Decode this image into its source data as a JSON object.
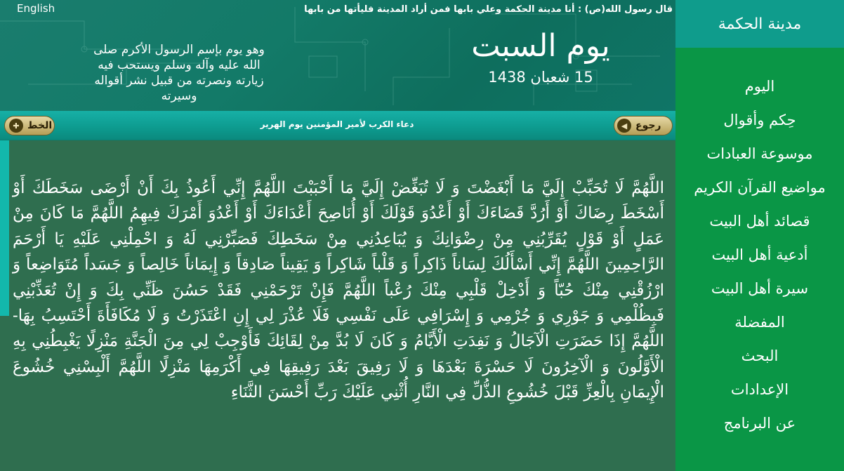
{
  "header": {
    "language_link": "English",
    "hadith": "قال رسول الله(ص) : أنا مدينة الحكمة وعلي بابها فمن أراد المدينة فليأتها من بابها",
    "day_name": "يوم السبت",
    "hijri_date": "15 شعبان 1438",
    "occasion": "وهو يوم بإسم الرسول الأكرم صلى الله عليه وآله وسلم ويستحب فيه زيارته ونصرته من قبيل نشر أقواله وسيرته"
  },
  "toolbar": {
    "font_button": "الخط",
    "title": "دعاء الكرب لأمير المؤمنين يوم الهرير",
    "back_button": "رجوع"
  },
  "prayer": {
    "text": "اللَّهُمَّ لَا تُحَبِّبْ إِلَيَّ مَا أَبْغَضْتَ وَ لَا تُبَغِّضْ إِلَيَّ مَا أَحْبَبْتَ اللَّهُمَّ إِنِّي أَعُوذُ بِكَ أَنْ أَرْضَى سَخَطَكَ أَوْ أَسْخَطَ رِضَاكَ أَوْ أَرُدَّ قَضَاءَكَ أَوْ أَعْدُوَ قَوْلَكَ أَوْ أُنَاصِحَ أَعْدَاءَكَ أَوْ أَعْدُوَ أَمْرَكَ فِيهِمُ اللَّهُمَّ مَا كَانَ مِنْ عَمَلٍ أَوْ قَوْلٍ يُقَرِّبُنِي مِنْ رِضْوَانِكَ وَ يُبَاعِدُنِي مِنْ سَخَطِكَ فَصَبِّرْنِي لَهُ وَ احْمِلْنِي عَلَيْهِ يَا أَرْحَمَ الرَّاحِمِينَ اللَّهُمَّ إِنِّي أَسْأَلُكَ لِسَاناً ذَاكِراً وَ قَلْباً شَاكِراً وَ يَقِيناً صَادِقاً وَ إِيمَاناً خَالِصاً وَ جَسَداً مُتَوَاضِعاً وَ ارْزُقْنِي مِنْكَ حُبّاً وَ أَدْخِلْ قَلْبِي مِنْكَ رُعْباً اللَّهُمَّ فَإِنْ تَرْحَمْنِي فَقَدْ حَسُنَ ظَنِّي بِكَ وَ إِنْ تُعَذِّبْنِي فَبِظُلْمِي وَ جَوْرِي وَ جُرْمِي وَ إِسْرَافِي عَلَى نَفْسِي فَلَا عُذْرَ لِي إِنِ اعْتَذَرْتُ وَ لَا مُكَافَأَةَ أَحْتَسِبُ بِهَا- اللَّهُمَّ إِذَا حَضَرَتِ الْآجَالُ وَ نَفِدَتِ الْأَيَّامُ وَ كَانَ لَا بُدَّ مِنْ لِقَائِكَ فَأَوْجِبْ لِي مِنَ الْجَنَّةِ مَنْزِلًا يَغْبِطُنِي بِهِ الْأَوَّلُونَ وَ الْآخِرُونَ لَا حَسْرَةَ بَعْدَهَا وَ لَا رَفِيقَ بَعْدَ رَفِيقِهَا فِي أَكْرَمِهَا مَنْزِلًا اللَّهُمَّ أَلْبِسْنِي خُشُوعَ الْإِيمَانِ بِالْعِزِّ قَبْلَ خُشُوعِ الذُّلِّ فِي النَّارِ أُثْنِي عَلَيْكَ رَبِّ أَحْسَنَ الثَّنَاءِ"
  },
  "sidebar": {
    "title": "مدينة الحكمة",
    "items": [
      {
        "label": "اليوم"
      },
      {
        "label": "حِكم وأقوال"
      },
      {
        "label": "موسوعة العبادات"
      },
      {
        "label": "مواضيع القرآن الكريم"
      },
      {
        "label": "قصائد أهل البيت"
      },
      {
        "label": "أدعية أهل البيت"
      },
      {
        "label": "سيرة أهل البيت"
      },
      {
        "label": "المفضلة"
      },
      {
        "label": "البحث"
      },
      {
        "label": "الإعدادات"
      },
      {
        "label": "عن البرنامج"
      }
    ]
  },
  "icons": {
    "font_button_icon": "plus-circle-icon",
    "back_button_icon": "back-arrow-icon"
  },
  "colors": {
    "sidebar_bg": "#0a9646",
    "sidebar_header_bg": "#0f9c8c",
    "toolbar_bg": "#0d9a8e",
    "content_bg": "#2f6e4f",
    "pill_gold": "#d4c07e"
  }
}
